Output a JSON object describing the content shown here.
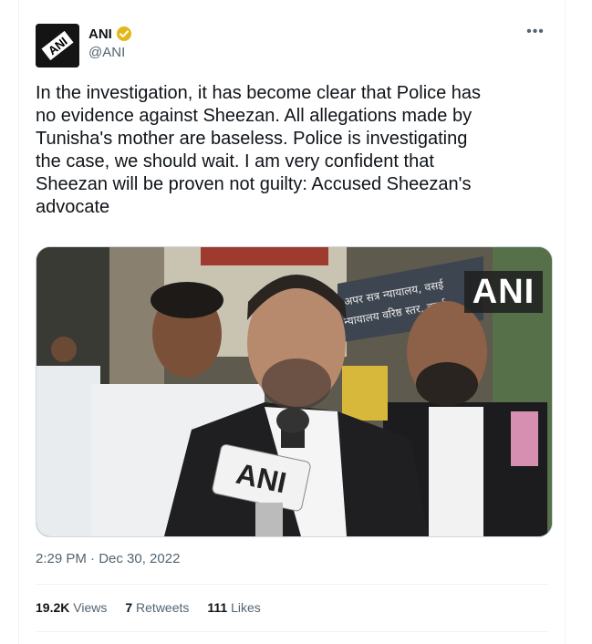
{
  "author": {
    "name": "ANI",
    "handle": "@ANI",
    "avatar_text": "ANI",
    "verified": true,
    "verified_color": "#e2b719"
  },
  "more_label": "•••",
  "tweet": {
    "text": "In the investigation, it has become clear that Police has\nno evidence against Sheezan. All allegations made by\nTunisha's mother are baseless. Police is investigating\nthe case, we should wait. I am very confident that\nSheezan will be proven not guilty: Accused Sheezan's\nadvocate",
    "timestamp": "2:29 PM · Dec 30, 2022"
  },
  "media": {
    "watermark": "ANI",
    "mic_label": "ANI",
    "sign_line1": "अपर सत्र न्यायालय, वसई",
    "sign_line2": "न्यायालय वरिष्ठ स्तर, वसई"
  },
  "stats": {
    "views_count": "19.2K",
    "views_label": "Views",
    "retweets_count": "7",
    "retweets_label": "Retweets",
    "likes_count": "111",
    "likes_label": "Likes"
  },
  "colors": {
    "text": "#0f1419",
    "secondary": "#536471",
    "border": "#eff3f4"
  }
}
